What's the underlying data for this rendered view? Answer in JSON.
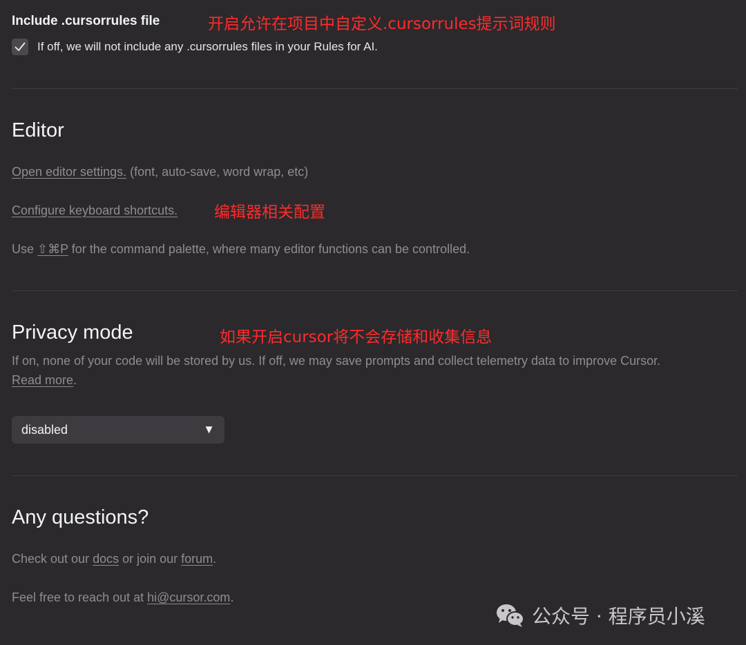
{
  "cursorrules": {
    "title": "Include .cursorrules file",
    "annotation": "开启允许在项目中自定义.cursorrules提示词规则",
    "checkbox_checked": true,
    "description": "If off, we will not include any .cursorrules files in your Rules for AI."
  },
  "editor": {
    "heading": "Editor",
    "open_settings_link": "Open editor settings.",
    "open_settings_suffix": " (font, auto-save, word wrap, etc)",
    "keyboard_link": "Configure keyboard shortcuts.",
    "annotation": "编辑器相关配置",
    "palette_prefix": "Use ",
    "palette_shortcut": "⇧⌘P",
    "palette_suffix": " for the command palette, where many editor functions can be controlled."
  },
  "privacy": {
    "heading": "Privacy mode",
    "annotation": "如果开启cursor将不会存储和收集信息",
    "description": "If on, none of your code will be stored by us. If off, we may save prompts and collect telemetry data to improve Cursor.",
    "read_more_link": "Read more",
    "read_more_suffix": ".",
    "select_value": "disabled",
    "select_arrow": "▼"
  },
  "questions": {
    "heading": "Any questions?",
    "docs_prefix": "Check out our ",
    "docs_link": "docs",
    "docs_middle": " or join our ",
    "forum_link": "forum",
    "docs_suffix": ".",
    "email_prefix": "Feel free to reach out at ",
    "email_link": "hi@cursor.com",
    "email_suffix": "."
  },
  "watermark": {
    "text": "公众号 · 程序员小溪",
    "icon": "wechat-icon"
  },
  "colors": {
    "background": "#2b292c",
    "annotation": "#ff2b2b",
    "muted_text": "#8f8d92"
  }
}
